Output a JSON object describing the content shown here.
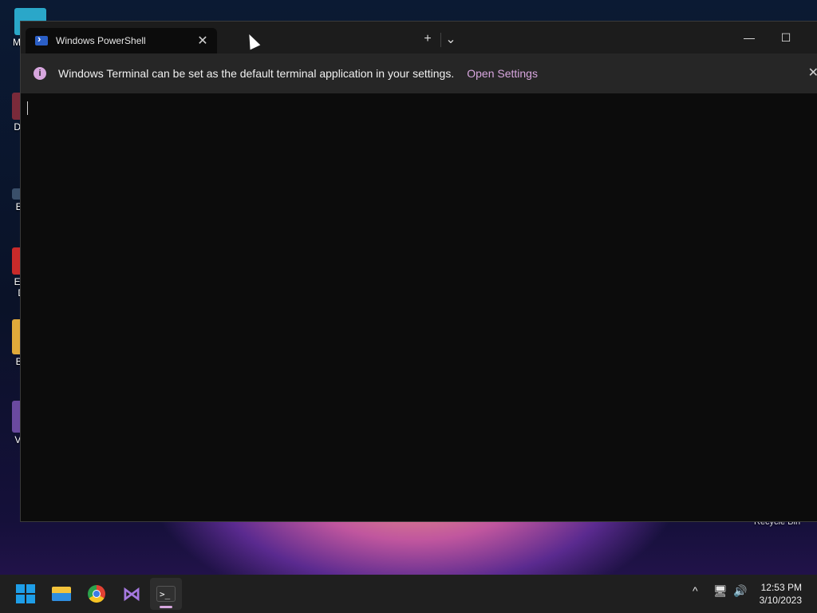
{
  "desktop": {
    "icons": [
      {
        "label": "My C"
      },
      {
        "label": "Data"
      },
      {
        "label": "Eve"
      },
      {
        "label": "Emb"
      },
      {
        "label": "De"
      },
      {
        "label": "Bac"
      },
      {
        "label": "Visu"
      }
    ],
    "recycle_label": "Recycle Bin"
  },
  "terminal": {
    "tab_title": "Windows PowerShell",
    "tab_close_glyph": "✕",
    "new_tab_glyph": "+",
    "dropdown_glyph": "⌄",
    "minimize_glyph": "—",
    "maximize_glyph": "☐",
    "infobar": {
      "icon_glyph": "i",
      "message": "Windows Terminal can be set as the default terminal application in your settings.",
      "link": "Open Settings",
      "close_glyph": "✕"
    }
  },
  "taskbar": {
    "apps": [
      "windows-start-icon",
      "file-explorer-icon",
      "chrome-icon",
      "visual-studio-icon",
      "terminal-icon"
    ],
    "terminal_glyph": ">_",
    "vs_glyph": "⋈",
    "tray_chevron": "^",
    "network_glyph": "🖥",
    "volume_glyph": "🔊",
    "time": "12:53 PM",
    "date": "3/10/2023"
  },
  "colors": {
    "accent": "#d7a6de",
    "terminal_bg": "#0c0c0c",
    "infobar_bg": "#262626",
    "taskbar_bg": "#1f1f1f"
  }
}
